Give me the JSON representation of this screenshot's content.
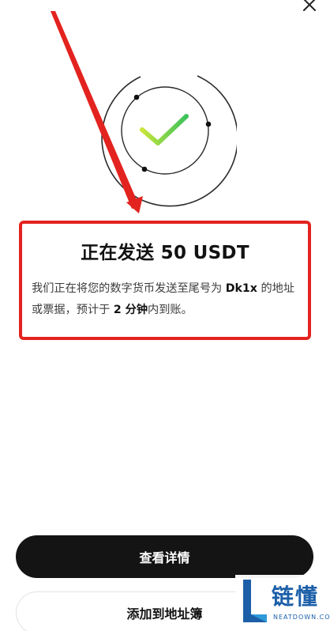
{
  "header": {
    "close_icon": "close-icon"
  },
  "illustration": {
    "icon": "check-icon",
    "check_color_start": "#c9e63a",
    "check_color_end": "#3cc25a",
    "ring_color": "#2a2a2a"
  },
  "annotation": {
    "color": "#e3231f"
  },
  "status": {
    "title": "正在发送 50 USDT",
    "desc_part1": "我们正在将您的数字货币发送至尾号为 ",
    "desc_tail": "Dk1x",
    "desc_part2": " 的地址或票据，预计于 ",
    "desc_time": "2 分钟",
    "desc_part3": "内到账。"
  },
  "actions": {
    "view_details": "查看详情",
    "add_to_address_book": "添加到地址簿"
  },
  "watermark": {
    "text": "链懂",
    "subtext": "NEATDOWN.COM"
  }
}
